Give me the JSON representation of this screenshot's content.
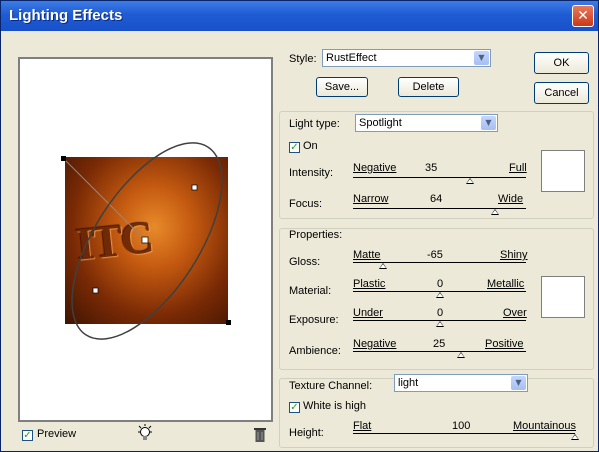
{
  "window": {
    "title": "Lighting Effects",
    "close": "✕"
  },
  "style": {
    "label": "Style:",
    "value": "RustEffect",
    "save": "Save...",
    "delete": "Delete"
  },
  "buttons": {
    "ok": "OK",
    "cancel": "Cancel"
  },
  "light": {
    "type_label": "Light type:",
    "type_value": "Spotlight",
    "on_label": "On",
    "on": true,
    "intensity": {
      "label": "Intensity:",
      "left": "Negative",
      "value": "35",
      "right": "Full",
      "level": 0.675
    },
    "focus": {
      "label": "Focus:",
      "left": "Narrow",
      "value": "64",
      "right": "Wide",
      "level": 0.82
    }
  },
  "properties": {
    "title": "Properties:",
    "gloss": {
      "label": "Gloss:",
      "left": "Matte",
      "value": "-65",
      "right": "Shiny",
      "level": 0.175
    },
    "material": {
      "label": "Material:",
      "left": "Plastic",
      "value": "0",
      "right": "Metallic",
      "level": 0.5
    },
    "exposure": {
      "label": "Exposure:",
      "left": "Under",
      "value": "0",
      "right": "Over",
      "level": 0.5
    },
    "ambience": {
      "label": "Ambience:",
      "left": "Negative",
      "value": "25",
      "right": "Positive",
      "level": 0.625
    }
  },
  "texture": {
    "channel_label": "Texture Channel:",
    "channel_value": "light",
    "white_high_label": "White is high",
    "white_high": true,
    "height": {
      "label": "Height:",
      "left": "Flat",
      "value": "100",
      "right": "Mountainous",
      "level": 1.0
    }
  },
  "preview": {
    "label": "Preview",
    "checked": true,
    "image_text": "ITC"
  },
  "icons": {
    "bulb": "light-bulb-icon",
    "trash": "trash-icon"
  }
}
